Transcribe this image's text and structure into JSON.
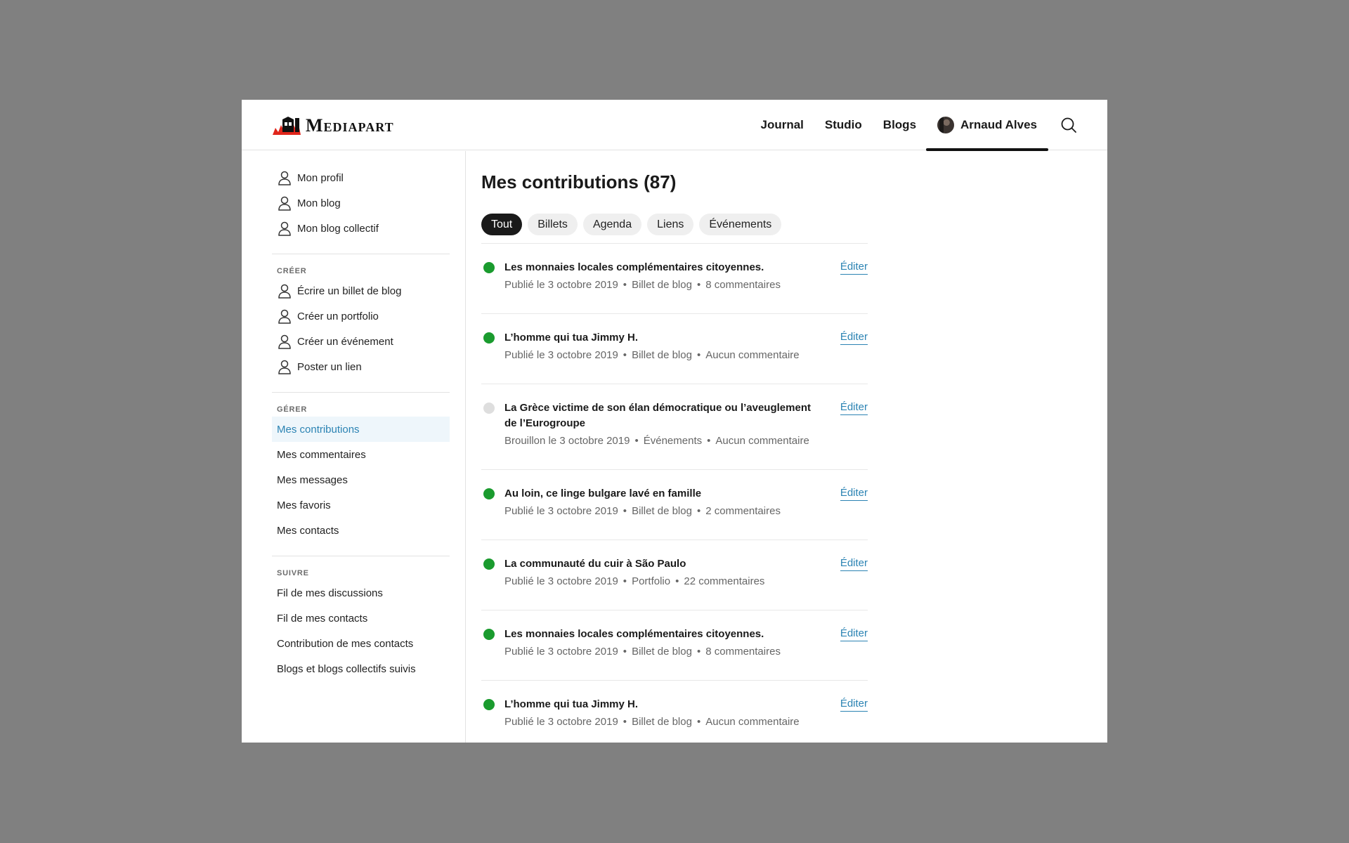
{
  "header": {
    "brand": "Mediapart",
    "nav": [
      "Journal",
      "Studio",
      "Blogs"
    ],
    "user_name": "Arnaud Alves"
  },
  "sidebar": {
    "profile_items": [
      "Mon profil",
      "Mon blog",
      "Mon blog collectif"
    ],
    "create_heading": "CRÉER",
    "create_items": [
      "Écrire un billet de blog",
      "Créer un portfolio",
      "Créer un événement",
      "Poster un lien"
    ],
    "manage_heading": "GÉRER",
    "manage_items": [
      "Mes contributions",
      "Mes commentaires",
      "Mes messages",
      "Mes favoris",
      "Mes contacts"
    ],
    "follow_heading": "SUIVRE",
    "follow_items": [
      "Fil de mes discussions",
      "Fil de mes contacts",
      "Contribution de mes contacts",
      "Blogs et blogs collectifs suivis"
    ]
  },
  "main": {
    "title": "Mes contributions (87)",
    "filters": [
      "Tout",
      "Billets",
      "Agenda",
      "Liens",
      "Événements"
    ],
    "edit_label": "Éditer",
    "items": [
      {
        "title": "Les monnaies locales complémentaires citoyennes.",
        "date": "Publié le 3 octobre 2019",
        "type": "Billet de blog",
        "comments": "8 commentaires",
        "status": "published"
      },
      {
        "title": "L’homme qui tua Jimmy H.",
        "date": "Publié le 3 octobre 2019",
        "type": "Billet de blog",
        "comments": "Aucun commentaire",
        "status": "published"
      },
      {
        "title": "La Grèce victime de son élan démocratique ou l’aveuglement de l’Eurogroupe",
        "date": "Brouillon le 3 octobre 2019",
        "type": "Événements",
        "comments": "Aucun commentaire",
        "status": "draft"
      },
      {
        "title": "Au loin, ce linge bulgare lavé en famille",
        "date": "Publié le 3 octobre 2019",
        "type": "Billet de blog",
        "comments": "2 commentaires",
        "status": "published"
      },
      {
        "title": "La communauté du cuir à São Paulo",
        "date": "Publié le 3 octobre 2019",
        "type": "Portfolio",
        "comments": "22 commentaires",
        "status": "published"
      },
      {
        "title": "Les monnaies locales complémentaires citoyennes.",
        "date": "Publié le 3 octobre 2019",
        "type": "Billet de blog",
        "comments": "8 commentaires",
        "status": "published"
      },
      {
        "title": "L’homme qui tua Jimmy H.",
        "date": "Publié le 3 octobre 2019",
        "type": "Billet de blog",
        "comments": "Aucun commentaire",
        "status": "published"
      }
    ]
  },
  "colors": {
    "accent": "#2b83b3",
    "published": "#1a9b2e",
    "draft": "#dedede",
    "active_chip": "#1a1a1a"
  }
}
